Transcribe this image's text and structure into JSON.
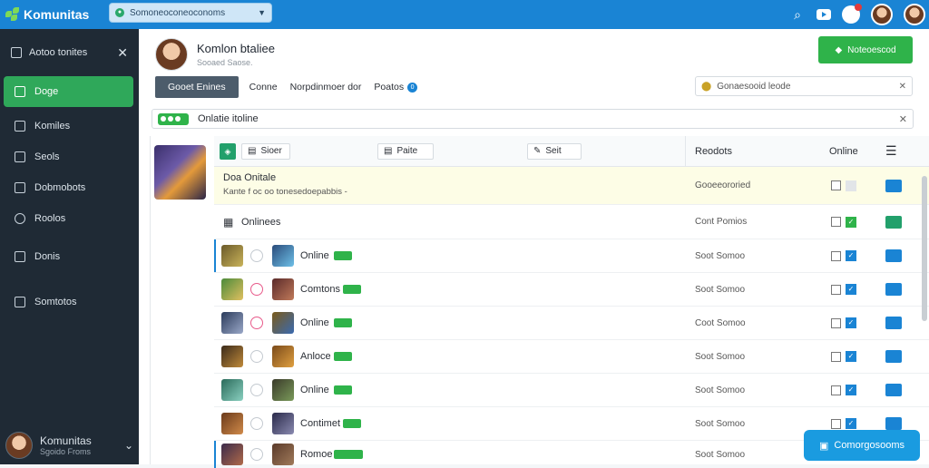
{
  "topbar": {
    "app_name": "Komunitas",
    "search": {
      "value": "Somoneoconeoconoms"
    },
    "colors": {
      "bar": "#1a84d4",
      "accent_green": "#2fb34a"
    }
  },
  "sidebar": {
    "header_label": "Aotoo tonites",
    "items": [
      {
        "label": "Doge",
        "icon": "square-icon",
        "active": true
      },
      {
        "label": "Komiles",
        "icon": "layers-icon"
      },
      {
        "label": "Seols",
        "icon": "list-icon"
      },
      {
        "label": "Dobmobots",
        "icon": "document-icon"
      },
      {
        "label": "Roolos",
        "icon": "circle-icon"
      },
      {
        "label": "Donis",
        "icon": "grid-icon"
      },
      {
        "label": "Somtotos",
        "icon": "people-icon"
      }
    ],
    "user": {
      "name": "Komunitas",
      "sub": "Sgoido Froms"
    }
  },
  "profile": {
    "name": "Komlon btaliee",
    "sub": "Sooaed Saose."
  },
  "add_button": "Noteoescod",
  "tabs": [
    {
      "label": "Gooet Enines",
      "active": true
    },
    {
      "label": "Conne"
    },
    {
      "label": "Norpdinmoer dor"
    },
    {
      "label": "Poatos",
      "badge": "0"
    }
  ],
  "right_search": {
    "value": "Gonaesooid leode"
  },
  "filter": {
    "label": "Onlatie itoline"
  },
  "table": {
    "header": {
      "chip1": "Sioer",
      "chip2": "Paite",
      "chip3": "Seit",
      "col_right": "Reodots",
      "col_online": "Online"
    },
    "featured": {
      "title": "Doa Onitale",
      "sub": "Kante f oc oo tonesedoepabbis -",
      "mid": "Gooeeororied"
    },
    "group": {
      "label": "Onlinees",
      "mid": "Cont Pomios"
    },
    "rows": [
      {
        "name": "Online",
        "mid": "Soot Somoo"
      },
      {
        "name": "Comtons",
        "mid": "Soot Somoo"
      },
      {
        "name": "Online",
        "mid": "Coot Somoo"
      },
      {
        "name": "Anloce",
        "mid": "Soot Somoo"
      },
      {
        "name": "Online",
        "mid": "Soot Somoo"
      },
      {
        "name": "Contimet",
        "mid": "Soot Somoo"
      },
      {
        "name": "Romoe",
        "mid": "Soot Somoo"
      }
    ]
  },
  "chat_button": "Comorgosooms"
}
